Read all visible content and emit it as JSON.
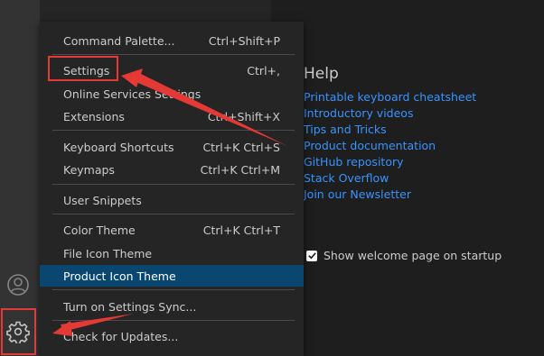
{
  "help": {
    "title": "Help",
    "links": [
      "Printable keyboard cheatsheet",
      "Introductory videos",
      "Tips and Tricks",
      "Product documentation",
      "GitHub repository",
      "Stack Overflow",
      "Join our Newsletter"
    ]
  },
  "startup": {
    "label": "Show welcome page on startup",
    "checked": true
  },
  "menu": {
    "items": [
      {
        "label": "Command Palette...",
        "shortcut": "Ctrl+Shift+P"
      },
      {
        "label": "Settings",
        "shortcut": "Ctrl+,"
      },
      {
        "label": "Online Services Settings",
        "shortcut": ""
      },
      {
        "label": "Extensions",
        "shortcut": "Ctrl+Shift+X"
      },
      {
        "label": "Keyboard Shortcuts",
        "shortcut": "Ctrl+K Ctrl+S"
      },
      {
        "label": "Keymaps",
        "shortcut": "Ctrl+K Ctrl+M"
      },
      {
        "label": "User Snippets",
        "shortcut": ""
      },
      {
        "label": "Color Theme",
        "shortcut": "Ctrl+K Ctrl+T"
      },
      {
        "label": "File Icon Theme",
        "shortcut": ""
      },
      {
        "label": "Product Icon Theme",
        "shortcut": ""
      },
      {
        "label": "Turn on Settings Sync...",
        "shortcut": ""
      },
      {
        "label": "Check for Updates...",
        "shortcut": ""
      }
    ],
    "selected_label": "Product Icon Theme"
  },
  "activity_bar": {
    "icons": [
      "account-icon",
      "manage-gear-icon"
    ]
  },
  "colors": {
    "selection": "#094771",
    "link": "#3794ff",
    "annotation": "#e53935"
  }
}
